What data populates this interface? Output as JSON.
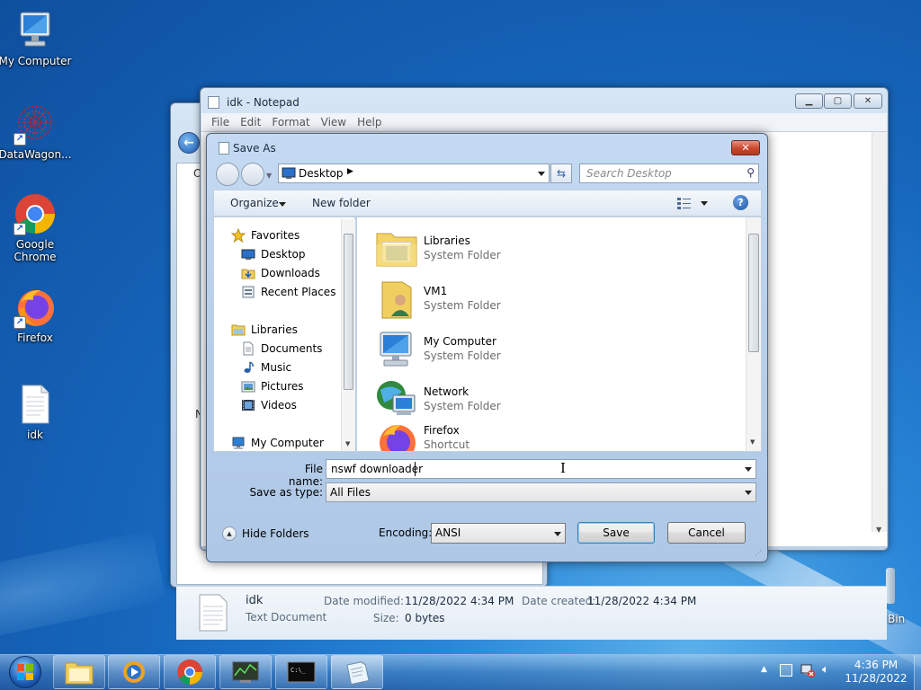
{
  "desktop": {
    "icons": [
      {
        "label": "My Computer",
        "icon": "computer-icon"
      },
      {
        "label": "DataWagon...",
        "icon": "datawagon-icon"
      },
      {
        "label": "Google\nChrome",
        "icon": "chrome-icon"
      },
      {
        "label": "Firefox",
        "icon": "firefox-icon"
      },
      {
        "label": "idk",
        "icon": "text-file-icon"
      },
      {
        "label": "Bin",
        "icon": "recycle-bin-icon"
      }
    ]
  },
  "notepad": {
    "title": "idk - Notepad",
    "menu": [
      "File",
      "Edit",
      "Format",
      "View",
      "Help"
    ]
  },
  "explorer_behind": {
    "details": {
      "name": "idk",
      "type": "Text Document",
      "modified_label": "Date modified:",
      "modified_value": "11/28/2022 4:34 PM",
      "created_label": "Date created:",
      "created_value": "11/28/2022 4:34 PM",
      "size_label": "Size:",
      "size_value": "0 bytes"
    },
    "partial_text": [
      "O",
      "l",
      "N"
    ]
  },
  "save_as": {
    "title": "Save As",
    "breadcrumb": "Desktop",
    "search_placeholder": "Search Desktop",
    "toolbar": {
      "organize": "Organize",
      "new_folder": "New folder"
    },
    "nav": {
      "favorites": "Favorites",
      "favorites_items": [
        "Desktop",
        "Downloads",
        "Recent Places"
      ],
      "libraries": "Libraries",
      "libraries_items": [
        "Documents",
        "Music",
        "Pictures",
        "Videos"
      ],
      "computer": "My Computer"
    },
    "files": [
      {
        "name": "Libraries",
        "type": "System Folder",
        "icon": "libraries-icon"
      },
      {
        "name": "VM1",
        "type": "System Folder",
        "icon": "user-folder-icon"
      },
      {
        "name": "My Computer",
        "type": "System Folder",
        "icon": "computer-icon"
      },
      {
        "name": "Network",
        "type": "System Folder",
        "icon": "network-icon"
      },
      {
        "name": "Firefox",
        "type": "Shortcut",
        "icon": "firefox-icon"
      }
    ],
    "file_name_label": "File name:",
    "file_name_value": "nswf downloader",
    "save_type_label": "Save as type:",
    "save_type_value": "All Files",
    "hide_folders": "Hide Folders",
    "encoding_label": "Encoding:",
    "encoding_value": "ANSI",
    "save_button": "Save",
    "cancel_button": "Cancel"
  },
  "taskbar": {
    "time": "4:36 PM",
    "date": "11/28/2022"
  },
  "colors": {
    "accent": "#1b58c8",
    "desktop": "#1a6fc0",
    "close_red": "#c9462c"
  }
}
